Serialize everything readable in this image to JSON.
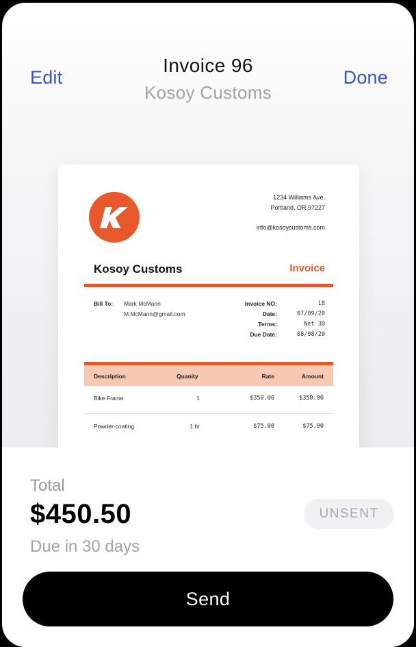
{
  "nav": {
    "edit_label": "Edit",
    "done_label": "Done",
    "title": "Invoice 96",
    "subtitle": "Kosoy Customs"
  },
  "invoice_preview": {
    "logo_letter": "K",
    "logo_icon": "k-logo-icon",
    "address_line1": "1234 Williams Ave,",
    "address_line2": "Portland, OR 97227",
    "email": "info@kosoycustoms.com",
    "company": "Kosoy Customs",
    "doc_type": "Invoice",
    "bill_to_label": "Bill To:",
    "bill_name": "Mark McMann",
    "bill_email": "M.McMann@gmail.com",
    "meta": [
      {
        "label": "Invoice NO:",
        "value": "18"
      },
      {
        "label": "Date:",
        "value": "07/09/20"
      },
      {
        "label": "Terms:",
        "value": "Net 30"
      },
      {
        "label": "Due Date:",
        "value": "08/08/20"
      }
    ],
    "table": {
      "headers": [
        "Description",
        "Quanity",
        "Rate",
        "Amount"
      ],
      "rows": [
        [
          "Bike Frame",
          "1",
          "$350.00",
          "$350.00"
        ],
        [
          "Powder-coating",
          "1 hr",
          "$75.00",
          "$75.00"
        ]
      ]
    },
    "accent_color": "#e8582a"
  },
  "summary": {
    "total_label": "Total",
    "total_amount": "$450.50",
    "due_text": "Due in 30 days",
    "status_badge": "UNSENT"
  },
  "actions": {
    "send_label": "Send"
  },
  "colors": {
    "link": "#3a4fd8",
    "primary_button": "#000000"
  }
}
